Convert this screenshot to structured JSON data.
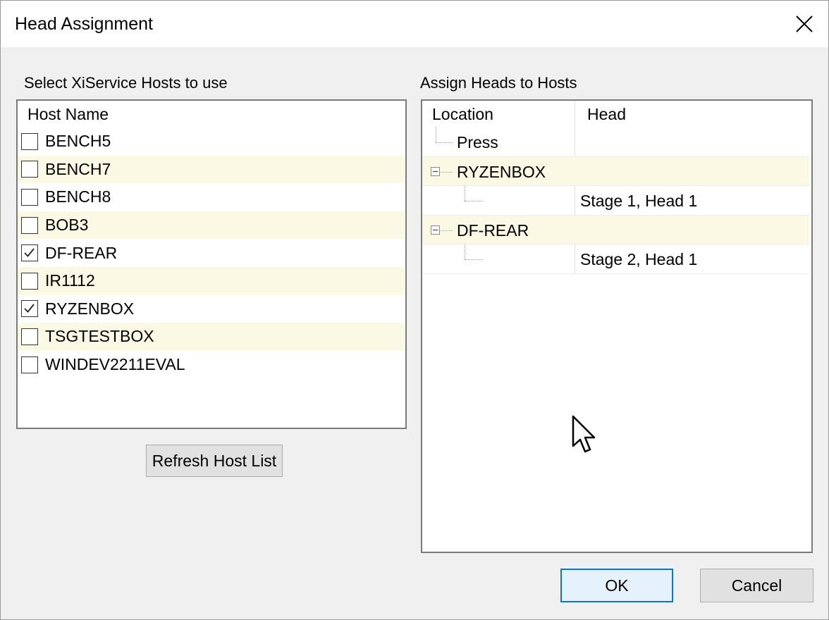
{
  "window": {
    "title": "Head Assignment"
  },
  "hosts_panel": {
    "label": "Select XiService Hosts to use",
    "column_header": "Host Name",
    "items": [
      {
        "name": "BENCH5",
        "checked": false
      },
      {
        "name": "BENCH7",
        "checked": false
      },
      {
        "name": "BENCH8",
        "checked": false
      },
      {
        "name": "BOB3",
        "checked": false
      },
      {
        "name": "DF-REAR",
        "checked": true
      },
      {
        "name": "IR1112",
        "checked": false
      },
      {
        "name": "RYZENBOX",
        "checked": true
      },
      {
        "name": "TSGTESTBOX",
        "checked": false
      },
      {
        "name": "WINDEV2211EVAL",
        "checked": false
      }
    ],
    "refresh_label": "Refresh Host List"
  },
  "heads_panel": {
    "label": "Assign Heads to Hosts",
    "columns": [
      "Location",
      "Head"
    ],
    "rows": [
      {
        "location": "Press",
        "head": ""
      },
      {
        "location": "RYZENBOX",
        "head": ""
      },
      {
        "location": "",
        "head": "Stage 1, Head 1"
      },
      {
        "location": "DF-REAR",
        "head": ""
      },
      {
        "location": "",
        "head": "Stage 2, Head 1"
      }
    ]
  },
  "footer": {
    "ok_label": "OK",
    "cancel_label": "Cancel"
  },
  "colors": {
    "alt_row": "#fbf8e3",
    "default_button_border": "#0078d7"
  }
}
